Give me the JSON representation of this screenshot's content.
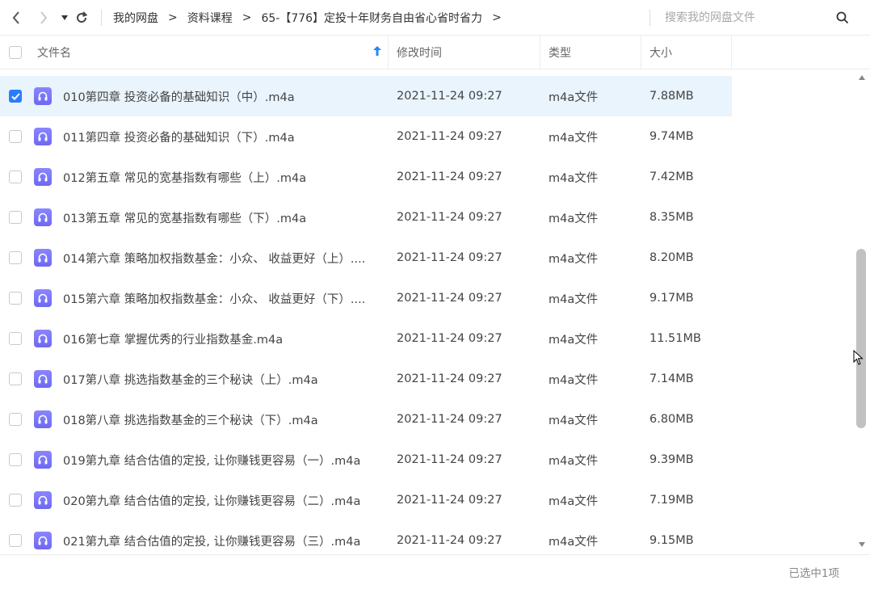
{
  "breadcrumb": [
    "我的网盘",
    "资料课程",
    "65-【776】定投十年财务自由省心省时省力"
  ],
  "breadcrumb_separator": ">",
  "search": {
    "placeholder": "搜索我的网盘文件"
  },
  "columns": {
    "name": "文件名",
    "modified": "修改时间",
    "type": "类型",
    "size": "大小"
  },
  "colors": {
    "accent": "#2a7cff",
    "selected_row": "#e9f4fd",
    "audio_icon": "#7a76f8"
  },
  "files": [
    {
      "name": "010第四章 投资必备的基础知识（中）.m4a",
      "modified": "2021-11-24 09:27",
      "type": "m4a文件",
      "size": "7.88MB",
      "checked": true,
      "icon": "audio-file-icon"
    },
    {
      "name": "011第四章 投资必备的基础知识（下）.m4a",
      "modified": "2021-11-24 09:27",
      "type": "m4a文件",
      "size": "9.74MB",
      "checked": false,
      "icon": "audio-file-icon"
    },
    {
      "name": "012第五章 常见的宽基指数有哪些（上）.m4a",
      "modified": "2021-11-24 09:27",
      "type": "m4a文件",
      "size": "7.42MB",
      "checked": false,
      "icon": "audio-file-icon"
    },
    {
      "name": "013第五章 常见的宽基指数有哪些（下）.m4a",
      "modified": "2021-11-24 09:27",
      "type": "m4a文件",
      "size": "8.35MB",
      "checked": false,
      "icon": "audio-file-icon"
    },
    {
      "name": "014第六章 策略加权指数基金：小众、 收益更好（上）....",
      "modified": "2021-11-24 09:27",
      "type": "m4a文件",
      "size": "8.20MB",
      "checked": false,
      "icon": "audio-file-icon"
    },
    {
      "name": "015第六章 策略加权指数基金：小众、 收益更好（下）....",
      "modified": "2021-11-24 09:27",
      "type": "m4a文件",
      "size": "9.17MB",
      "checked": false,
      "icon": "audio-file-icon"
    },
    {
      "name": "016第七章 掌握优秀的行业指数基金.m4a",
      "modified": "2021-11-24 09:27",
      "type": "m4a文件",
      "size": "11.51MB",
      "checked": false,
      "icon": "audio-file-icon"
    },
    {
      "name": "017第八章 挑选指数基金的三个秘诀（上）.m4a",
      "modified": "2021-11-24 09:27",
      "type": "m4a文件",
      "size": "7.14MB",
      "checked": false,
      "icon": "audio-file-icon"
    },
    {
      "name": "018第八章 挑选指数基金的三个秘诀（下）.m4a",
      "modified": "2021-11-24 09:27",
      "type": "m4a文件",
      "size": "6.80MB",
      "checked": false,
      "icon": "audio-file-icon"
    },
    {
      "name": "019第九章 结合估值的定投, 让你赚钱更容易（一）.m4a",
      "modified": "2021-11-24 09:27",
      "type": "m4a文件",
      "size": "9.39MB",
      "checked": false,
      "icon": "audio-file-icon"
    },
    {
      "name": "020第九章 结合估值的定投, 让你赚钱更容易（二）.m4a",
      "modified": "2021-11-24 09:27",
      "type": "m4a文件",
      "size": "7.19MB",
      "checked": false,
      "icon": "audio-file-icon"
    },
    {
      "name": "021第九章 结合估值的定投, 让你赚钱更容易（三）.m4a",
      "modified": "2021-11-24 09:27",
      "type": "m4a文件",
      "size": "9.15MB",
      "checked": false,
      "icon": "audio-file-icon"
    }
  ],
  "status": {
    "selected_text": "已选中1项"
  }
}
